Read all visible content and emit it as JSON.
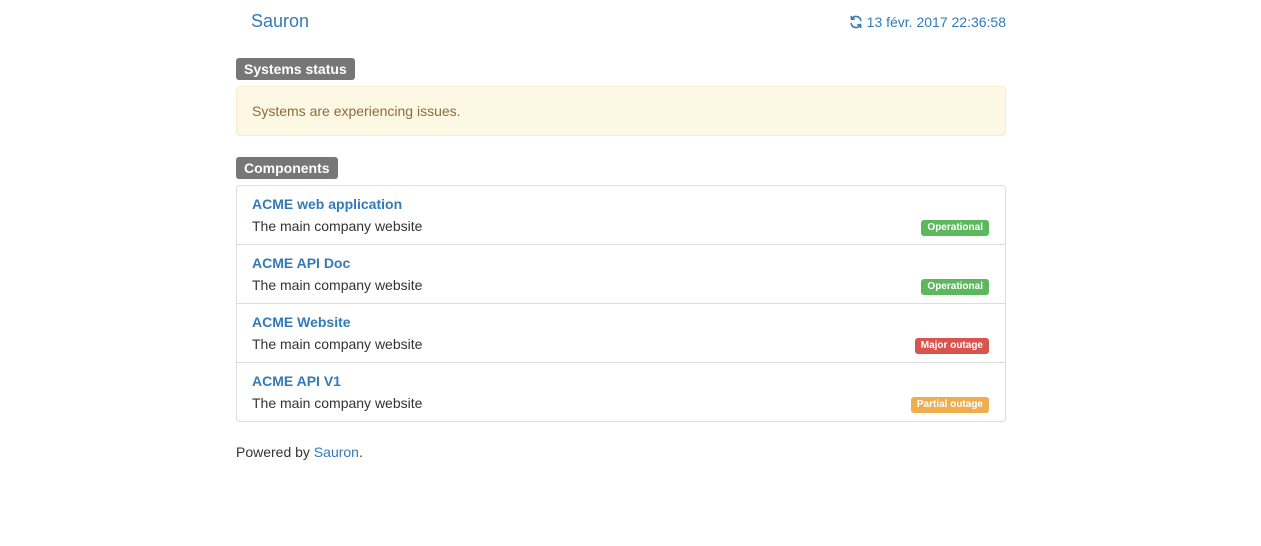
{
  "header": {
    "brand": "Sauron",
    "timestamp": "13 févr. 2017 22:36:58"
  },
  "systems": {
    "label": "Systems status",
    "message": "Systems are experiencing issues."
  },
  "components": {
    "label": "Components",
    "items": [
      {
        "name": "ACME web application",
        "description": "The main company website",
        "status": "Operational",
        "status_color": "#5cb85c"
      },
      {
        "name": "ACME API Doc",
        "description": "The main company website",
        "status": "Operational",
        "status_color": "#5cb85c"
      },
      {
        "name": "ACME Website",
        "description": "The main company website",
        "status": "Major outage",
        "status_color": "#d9534f"
      },
      {
        "name": "ACME API V1",
        "description": "The main company website",
        "status": "Partial outage",
        "status_color": "#f0ad4e"
      }
    ]
  },
  "footer": {
    "prefix": "Powered by ",
    "link": "Sauron",
    "suffix": "."
  },
  "colors": {
    "link": "#337ab7",
    "label_bg": "#777777",
    "warning_bg": "#fcf8e3",
    "warning_text": "#8a6d3b"
  },
  "icons": {
    "refresh": "refresh-icon"
  }
}
